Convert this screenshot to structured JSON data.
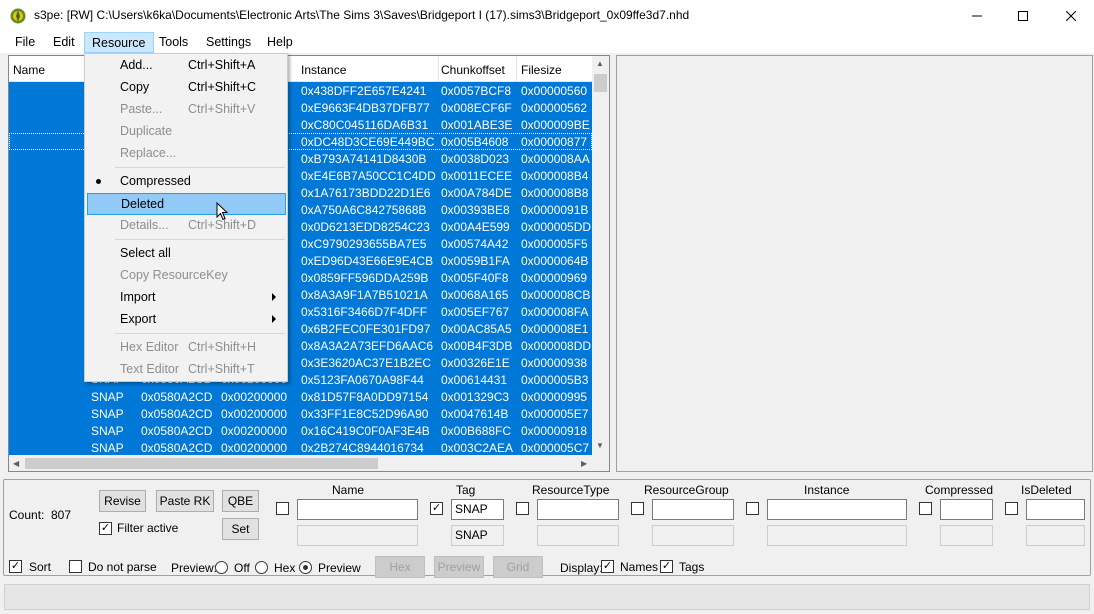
{
  "window": {
    "title": "s3pe: [RW] C:\\Users\\k6ka\\Documents\\Electronic Arts\\The Sims 3\\Saves\\Bridgeport I (17).sims3\\Bridgeport_0x09ffe3d7.nhd",
    "icon": "s3pe-app-icon"
  },
  "menubar": [
    "File",
    "Edit",
    "Resource",
    "Tools",
    "Settings",
    "Help"
  ],
  "list": {
    "columns": [
      "Name",
      "Instance",
      "Chunkoffset",
      "Filesize"
    ],
    "rows_top": [
      [
        "0x438DFF2E657E4241",
        "0x0057BCF8",
        "0x00000560"
      ],
      [
        "0xE9663F4DB37DFB77",
        "0x008ECF6F",
        "0x00000562"
      ],
      [
        "0xC80C045116DA6B31",
        "0x001ABE3E",
        "0x000009BE"
      ],
      [
        "0xDC48D3CE69E449BC",
        "0x005B4608",
        "0x00000877"
      ],
      [
        "0xB793A74141D8430B",
        "0x0038D023",
        "0x000008AA"
      ],
      [
        "0xE4E6B7A50CC1C4DD",
        "0x0011ECEE",
        "0x000008B4"
      ],
      [
        "0x1A76173BDD22D1E6",
        "0x00A784DE",
        "0x000008B8"
      ],
      [
        "0xA750A6C84275868B",
        "0x00393BE8",
        "0x0000091B"
      ],
      [
        "0x0D6213EDD8254C23",
        "0x00A4E599",
        "0x000005DD"
      ],
      [
        "0xC9790293655BA7E5",
        "0x00574A42",
        "0x000005F5"
      ],
      [
        "0xED96D43E66E9E4CB",
        "0x0059B1FA",
        "0x0000064B"
      ],
      [
        "0x0859FF596DDA259B",
        "0x005F40F8",
        "0x00000969"
      ],
      [
        "0x8A3A9F1A7B51021A",
        "0x0068A165",
        "0x000008CB"
      ],
      [
        "0x5316F3466D7F4DFF",
        "0x005EF767",
        "0x000008FA"
      ],
      [
        "0x6B2FEC0FE301FD97",
        "0x00AC85A5",
        "0x000008E1"
      ],
      [
        "0x8A3A2A73EFD6AAC6",
        "0x00B4F3DB",
        "0x000008DD"
      ],
      [
        "0x3E3620AC37E1B2EC",
        "0x00326E1E",
        "0x00000938"
      ],
      [
        "0x5123FA0670A98F44",
        "0x00614431",
        "0x000005B3"
      ]
    ],
    "partial_row_fragments": [
      "SNAP",
      "0x0580A2CD",
      "0x00200000"
    ],
    "rows_full": [
      [
        "SNAP",
        "0x0580A2CD",
        "0x00200000",
        "0x81D57F8A0DD97154",
        "0x001329C3",
        "0x00000995"
      ],
      [
        "SNAP",
        "0x0580A2CD",
        "0x00200000",
        "0x33FF1E8C52D96A90",
        "0x0047614B",
        "0x000005E7"
      ],
      [
        "SNAP",
        "0x0580A2CD",
        "0x00200000",
        "0x16C419C0F0AF3E4B",
        "0x00B688FC",
        "0x00000918"
      ],
      [
        "SNAP",
        "0x0580A2CD",
        "0x00200000",
        "0x2B274C8944016734",
        "0x003C2AEA",
        "0x000005C7"
      ]
    ]
  },
  "resource_menu": [
    {
      "label": "Add...",
      "shortcut": "Ctrl+Shift+A",
      "enabled": true
    },
    {
      "label": "Copy",
      "shortcut": "Ctrl+Shift+C",
      "enabled": true
    },
    {
      "label": "Paste...",
      "shortcut": "Ctrl+Shift+V",
      "enabled": false
    },
    {
      "label": "Duplicate",
      "shortcut": "",
      "enabled": false
    },
    {
      "label": "Replace...",
      "shortcut": "",
      "enabled": false
    },
    {
      "label": "Compressed",
      "shortcut": "",
      "enabled": true,
      "checked": true
    },
    {
      "label": "Deleted",
      "shortcut": "",
      "enabled": true,
      "hovered": true
    },
    {
      "label": "Details...",
      "shortcut": "Ctrl+Shift+D",
      "enabled": false
    },
    {
      "label": "Select all",
      "shortcut": "",
      "enabled": true
    },
    {
      "label": "Copy ResourceKey",
      "shortcut": "",
      "enabled": false
    },
    {
      "label": "Import",
      "shortcut": "",
      "enabled": true,
      "submenu": true
    },
    {
      "label": "Export",
      "shortcut": "",
      "enabled": true,
      "submenu": true
    },
    {
      "label": "Hex Editor",
      "shortcut": "Ctrl+Shift+H",
      "enabled": false
    },
    {
      "label": "Text Editor",
      "shortcut": "Ctrl+Shift+T",
      "enabled": false
    }
  ],
  "filter": {
    "count_label": "Count:",
    "count_value": "807",
    "revise_label": "Revise",
    "paste_rk_label": "Paste RK",
    "qbe_label": "QBE",
    "set_label": "Set",
    "filter_active_label": "Filter active",
    "filter_active_checked": true,
    "fields": [
      {
        "label": "Name",
        "checked": false,
        "value": "",
        "value2": ""
      },
      {
        "label": "Tag",
        "checked": true,
        "value": "SNAP",
        "value2": "SNAP"
      },
      {
        "label": "ResourceType",
        "checked": false,
        "value": "",
        "value2": ""
      },
      {
        "label": "ResourceGroup",
        "checked": false,
        "value": "",
        "value2": ""
      },
      {
        "label": "Instance",
        "checked": false,
        "value": "",
        "value2": ""
      },
      {
        "label": "Compressed",
        "checked": false,
        "value": "",
        "value2": ""
      },
      {
        "label": "IsDeleted",
        "checked": false,
        "value": "",
        "value2": ""
      }
    ]
  },
  "options": {
    "sort_label": "Sort",
    "sort_checked": true,
    "do_not_parse_label": "Do not parse",
    "do_not_parse_checked": false,
    "preview_label": "Preview:",
    "preview_options": [
      "Off",
      "Hex",
      "Preview"
    ],
    "preview_selected": "Preview",
    "hex_btn": "Hex",
    "preview_btn": "Preview",
    "grid_btn": "Grid",
    "display_label": "Display:",
    "names_label": "Names",
    "names_checked": true,
    "tags_label": "Tags",
    "tags_checked": true
  },
  "colors": {
    "selection": "#0078d7",
    "menu_hover": "#91c9f7",
    "menu_open_bg": "#cce8ff"
  }
}
